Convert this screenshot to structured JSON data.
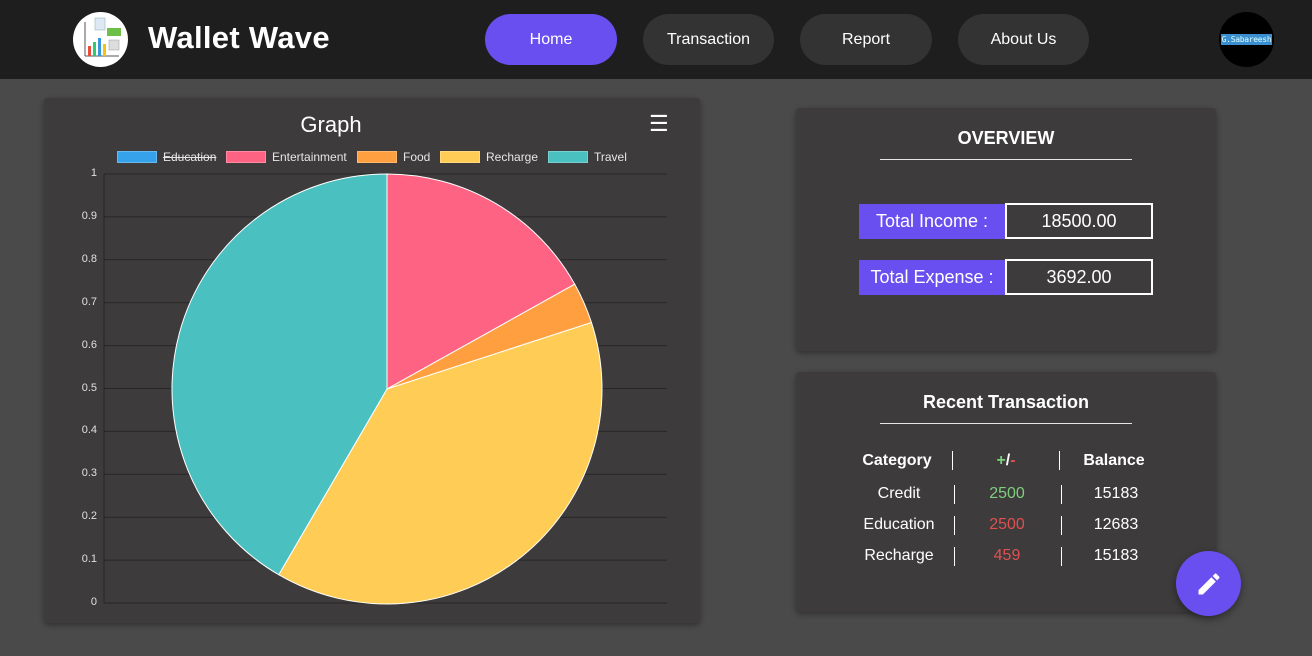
{
  "app": {
    "brand": "Wallet Wave",
    "avatar_text": "G.Sabareesh"
  },
  "nav": {
    "items": [
      {
        "label": "Home",
        "active": true
      },
      {
        "label": "Transaction",
        "active": false
      },
      {
        "label": "Report",
        "active": false
      },
      {
        "label": "About Us",
        "active": false
      }
    ]
  },
  "graph": {
    "title": "Graph",
    "menu_icon": "hamburger-menu-icon"
  },
  "chart_data": {
    "type": "pie",
    "title": "Graph",
    "legend_position": "top",
    "categories": [
      "Education",
      "Entertainment",
      "Food",
      "Recharge",
      "Travel"
    ],
    "hidden": [
      "Education"
    ],
    "colors": [
      "#36a2eb",
      "#ff6384",
      "#ff9f40",
      "#ffcd56",
      "#4bc0c0"
    ],
    "values": [
      0,
      0.169,
      0.031,
      0.384,
      0.416
    ],
    "y_ticks": [
      "1",
      "0.9",
      "0.8",
      "0.7",
      "0.6",
      "0.5",
      "0.4",
      "0.3",
      "0.2",
      "0.1",
      "0"
    ],
    "ylim": [
      0,
      1
    ],
    "grid": true
  },
  "overview": {
    "title": "OVERVIEW",
    "income_label": "Total Income :",
    "income_value": "18500.00",
    "expense_label": "Total Expense :",
    "expense_value": "3692.00"
  },
  "recent": {
    "title": "Recent Transaction",
    "headers": {
      "category": "Category",
      "plus": "+",
      "slash": "/",
      "minus": "-",
      "balance": "Balance"
    },
    "rows": [
      {
        "category": "Credit",
        "amount": "2500",
        "type": "credit",
        "balance": "15183"
      },
      {
        "category": "Education",
        "amount": "2500",
        "type": "debit",
        "balance": "12683"
      },
      {
        "category": "Recharge",
        "amount": "459",
        "type": "debit",
        "balance": "15183"
      }
    ]
  },
  "colors": {
    "accent": "#6a4ff0",
    "background": "#4a4a4a",
    "card": "#3d3b3b",
    "header": "#1e1e1e",
    "credit": "#7ed07e",
    "debit": "#e05050"
  },
  "fab": {
    "icon": "pencil-icon"
  }
}
